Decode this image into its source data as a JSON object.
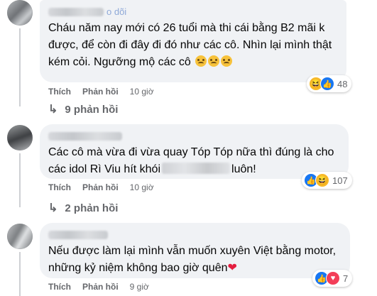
{
  "comments": [
    {
      "follow_text": "o dõi",
      "text": "Cháu năm nay mới có 26 tuổi mà thi cái bằng B2 mãi k được, để còn đi đây đi đó như các cô. Nhìn lại mình thật kém cỏi. Ngưỡng mộ các cô",
      "emoji_count": 3,
      "reaction_icons": [
        "haha-icon",
        "like-icon"
      ],
      "reaction_count": "48",
      "actions": {
        "like": "Thích",
        "reply": "Phản hồi",
        "time": "10 giờ"
      },
      "replies_label": "9 phản hồi"
    },
    {
      "text_before": "Các cô mà vừa đi vừa quay Tóp Tóp nữa thì đúng là cho các idol Rì Viu hít khói",
      "text_after": "luôn!",
      "reaction_icons": [
        "like-icon",
        "haha-icon"
      ],
      "reaction_count": "107",
      "actions": {
        "like": "Thích",
        "reply": "Phản hồi",
        "time": "10 giờ"
      },
      "replies_label": "2 phản hồi"
    },
    {
      "text": "Nếu được làm lại mình vẫn muốn xuyên Việt bằng motor, những kỷ niệm không bao giờ quên",
      "reaction_icons": [
        "like-icon",
        "heart-icon"
      ],
      "reaction_count": "7",
      "actions": {
        "like": "Thích",
        "reply": "Phản hồi",
        "time": "9 giờ"
      }
    }
  ],
  "colors": {
    "bubble": "#f0f2f5",
    "secondary_text": "#65676b",
    "like_blue": "#1877f2",
    "heart_red": "#e41e3f"
  }
}
